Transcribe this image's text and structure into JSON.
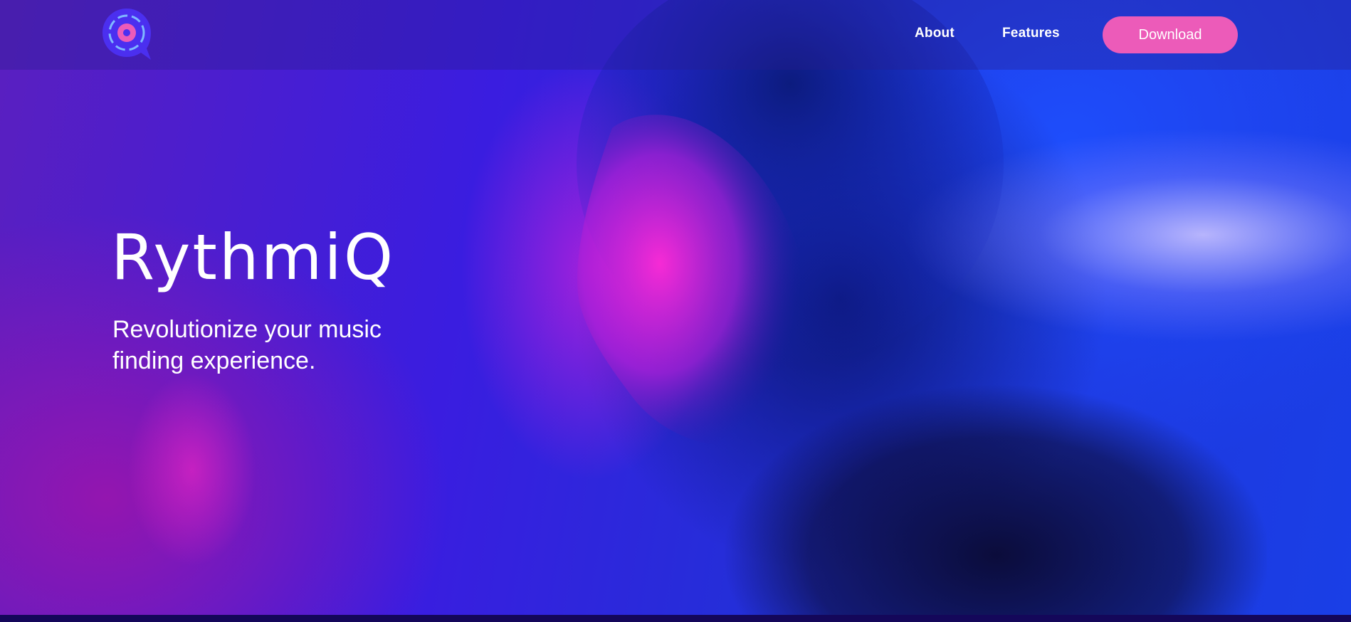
{
  "nav": {
    "logo_icon": "vinyl-speech-bubble-icon",
    "links": [
      {
        "label": "About"
      },
      {
        "label": "Features"
      }
    ],
    "download_label": "Download"
  },
  "hero": {
    "title": "RythmiQ",
    "subtitle": "Revolutionize your music finding experience."
  },
  "colors": {
    "accent": "#ec5bb9",
    "logo_bg": "#4b2ff0",
    "logo_ring": "#ec5bb9",
    "background_deep": "#1a0a6e"
  }
}
